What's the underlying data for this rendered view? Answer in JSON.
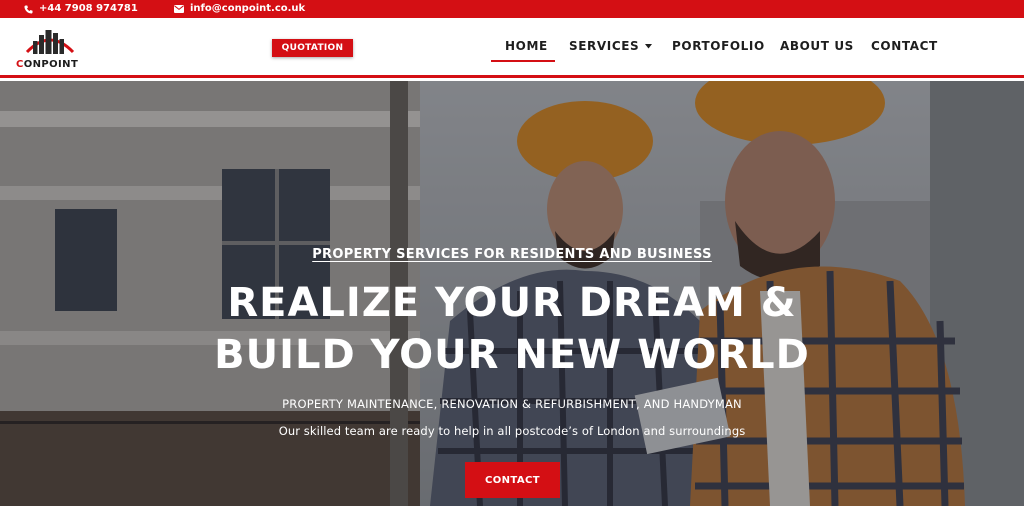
{
  "topbar": {
    "phone": "+44 7908 974781",
    "email": "info@conpoint.co.uk",
    "phone_icon": "phone-icon",
    "email_icon": "envelope-icon"
  },
  "brand": {
    "name_first": "C",
    "name_rest": "ONPOINT",
    "logo_icon": "building-roof-logo-icon"
  },
  "nav": {
    "quotation_label": "QUOTATION",
    "items": [
      {
        "label": "HOME",
        "active": true
      },
      {
        "label": "SERVICES",
        "has_dropdown": true
      },
      {
        "label": "PORTOFOLIO"
      },
      {
        "label": "ABOUT US"
      },
      {
        "label": "CONTACT"
      }
    ]
  },
  "hero": {
    "subtitle": "PROPERTY SERVICES FOR RESIDENTS AND BUSINESS",
    "title_line1": "REALIZE YOUR DREAM &",
    "title_line2": "BUILD YOUR NEW WORLD",
    "description": "PROPERTY MAINTENANCE, RENOVATION & REFURBISHMENT, AND HANDYMAN",
    "tagline": "Our skilled team are ready to help in all postcode’s of London and surroundings",
    "cta_label": "CONTACT"
  },
  "colors": {
    "brand_red": "#d40f14",
    "text_dark": "#1e1e1e",
    "white": "#ffffff"
  }
}
